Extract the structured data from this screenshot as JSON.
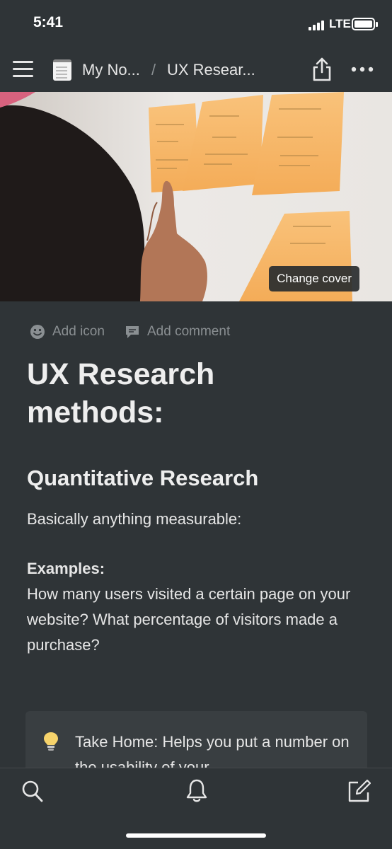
{
  "status_bar": {
    "time": "5:41",
    "network": "LTE"
  },
  "nav": {
    "breadcrumb_parent": "My No...",
    "breadcrumb_separator": "/",
    "breadcrumb_current": "UX Resear...",
    "icons": [
      "menu-icon",
      "notebook-icon",
      "share-icon",
      "more-icon"
    ]
  },
  "cover": {
    "change_cover_label": "Change cover"
  },
  "page_actions": {
    "add_icon_label": "Add icon",
    "add_comment_label": "Add comment"
  },
  "page": {
    "title": "UX Research methods:",
    "heading": "Quantitative Research",
    "intro": "Basically anything measurable:",
    "examples_label": "Examples:",
    "examples_text": "How many users visited a certain page on your website? What percentage of visitors made a purchase?"
  },
  "callout": {
    "icon": "lightbulb-icon",
    "text": "Take Home: Helps you put a number on the usability of your"
  },
  "bottom_bar": {
    "icons": [
      "search-icon",
      "bell-icon",
      "compose-icon"
    ]
  },
  "colors": {
    "background": "#2f3437",
    "callout_bg": "#393e41",
    "muted_text": "#8a8f92",
    "accent_note": "#f7b267"
  }
}
